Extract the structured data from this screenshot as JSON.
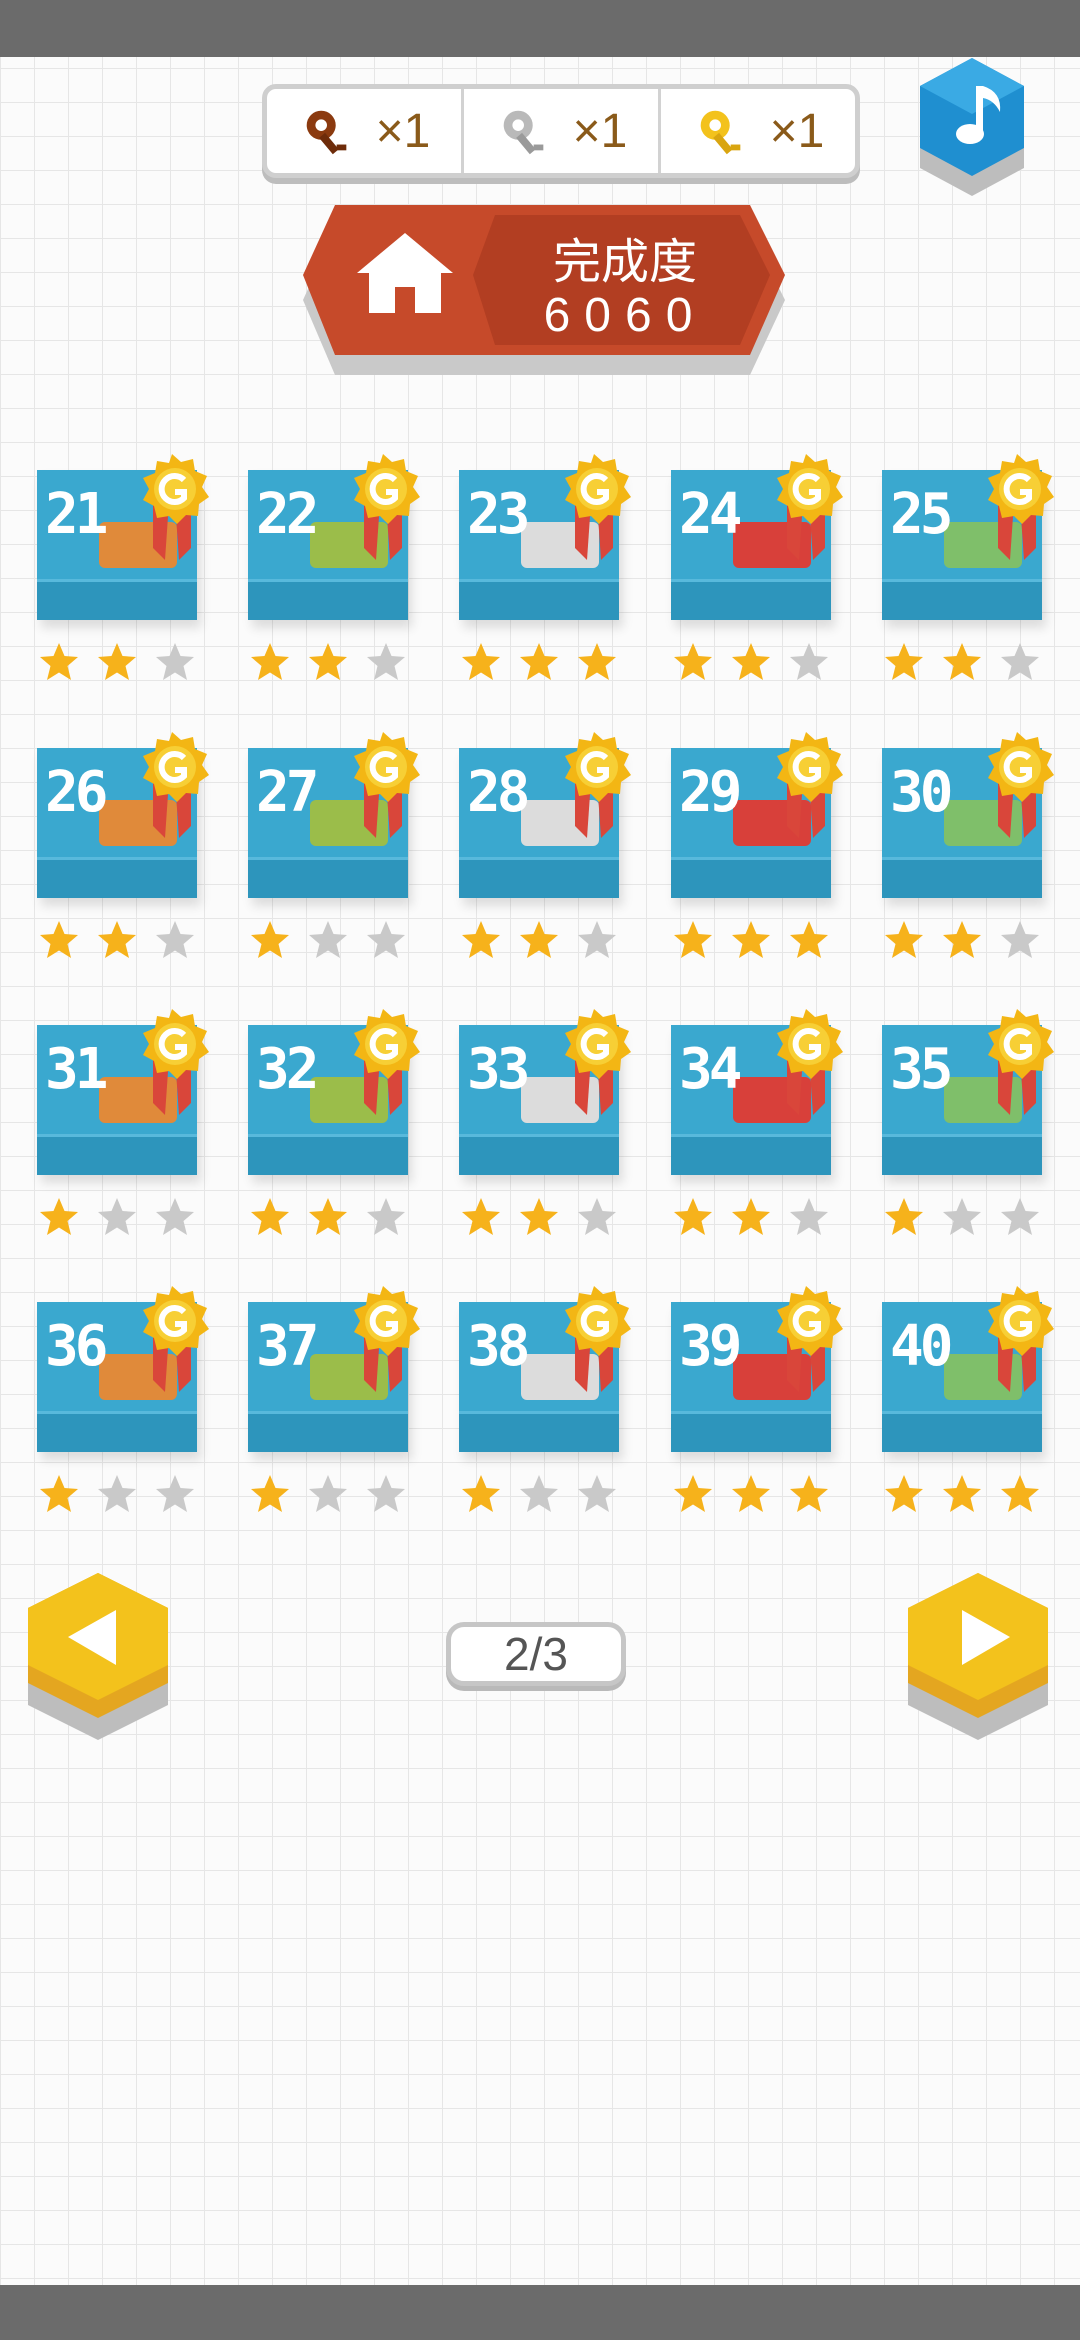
{
  "keys": [
    {
      "name": "bronze-key",
      "count": "×1",
      "color": "#8b3a0f"
    },
    {
      "name": "silver-key",
      "count": "×1",
      "color": "#b9b9b9"
    },
    {
      "name": "gold-key",
      "count": "×1",
      "color": "#f3c21c"
    }
  ],
  "banner": {
    "title": "完成度",
    "value": "6060"
  },
  "levels": [
    {
      "num": "21",
      "stars": 2
    },
    {
      "num": "22",
      "stars": 2
    },
    {
      "num": "23",
      "stars": 3
    },
    {
      "num": "24",
      "stars": 2
    },
    {
      "num": "25",
      "stars": 2
    },
    {
      "num": "26",
      "stars": 2
    },
    {
      "num": "27",
      "stars": 1
    },
    {
      "num": "28",
      "stars": 2
    },
    {
      "num": "29",
      "stars": 3
    },
    {
      "num": "30",
      "stars": 2
    },
    {
      "num": "31",
      "stars": 1
    },
    {
      "num": "32",
      "stars": 2
    },
    {
      "num": "33",
      "stars": 2
    },
    {
      "num": "34",
      "stars": 2
    },
    {
      "num": "35",
      "stars": 1
    },
    {
      "num": "36",
      "stars": 1
    },
    {
      "num": "37",
      "stars": 1
    },
    {
      "num": "38",
      "stars": 1
    },
    {
      "num": "39",
      "stars": 3
    },
    {
      "num": "40",
      "stars": 3
    }
  ],
  "pagination": {
    "label": "2/3"
  },
  "colors": {
    "tile": "#3aa8cf",
    "banner": "#c64a2a",
    "star_on": "#f6b21b",
    "star_off": "#c9c9c9",
    "arrow": "#f3c21c",
    "music": "#1f8fd0"
  }
}
